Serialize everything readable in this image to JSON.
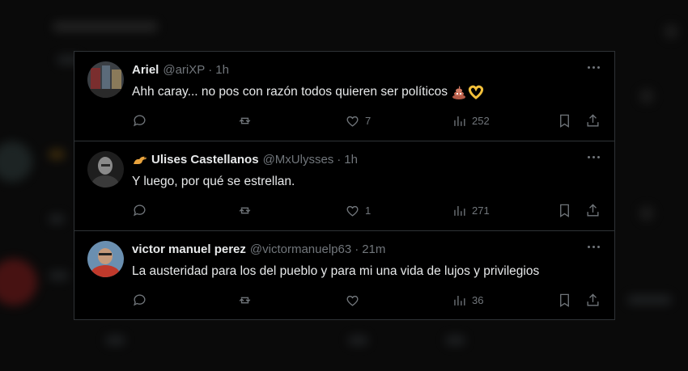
{
  "tweets": [
    {
      "name": "Ariel",
      "handle": "@ariXP",
      "sep": "·",
      "time": "1h",
      "text": "Ahh caray... no pos con razón todos quieren ser políticos",
      "emojis": [
        "pile-of-poo-emoji",
        "heart-hands-emoji"
      ],
      "likes": "7",
      "views": "252"
    },
    {
      "name": "Ulises Castellanos",
      "handle": "@MxUlysses",
      "sep": "·",
      "time": "1h",
      "name_emoji": "dinosaur-emoji",
      "text": "Y luego, por qué se estrellan.",
      "likes": "1",
      "views": "271"
    },
    {
      "name": "victor manuel perez",
      "handle": "@victormanuelp63",
      "sep": "·",
      "time": "21m",
      "text": "La austeridad para los del pueblo y para mi una vida de lujos y privilegios",
      "likes": "",
      "views": "36"
    }
  ],
  "colors": {
    "background": "#000000",
    "text": "#e7e9ea",
    "muted": "#71767b",
    "border": "#2f3336"
  }
}
